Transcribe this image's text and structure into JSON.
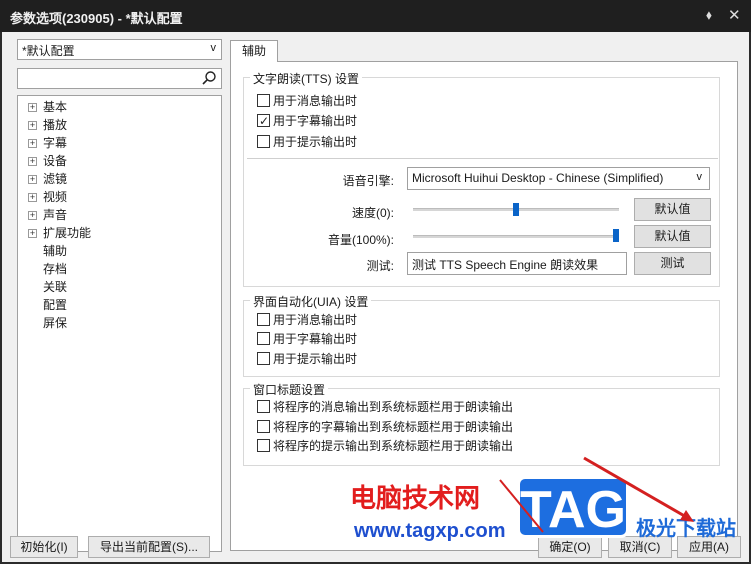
{
  "window": {
    "title": "参数选项(230905) - *默认配置",
    "pin_icon": "pin-icon",
    "close_icon": "close-icon"
  },
  "left": {
    "profile_select": "*默认配置",
    "search_placeholder": "",
    "tree": [
      {
        "label": "基本",
        "expandable": true
      },
      {
        "label": "播放",
        "expandable": true
      },
      {
        "label": "字幕",
        "expandable": true
      },
      {
        "label": "设备",
        "expandable": true
      },
      {
        "label": "滤镜",
        "expandable": true
      },
      {
        "label": "视频",
        "expandable": true
      },
      {
        "label": "声音",
        "expandable": true
      },
      {
        "label": "扩展功能",
        "expandable": true
      },
      {
        "label": "辅助",
        "expandable": false
      },
      {
        "label": "存档",
        "expandable": false
      },
      {
        "label": "关联",
        "expandable": false
      },
      {
        "label": "配置",
        "expandable": false
      },
      {
        "label": "屏保",
        "expandable": false
      }
    ]
  },
  "tab": {
    "label": "辅助"
  },
  "tts": {
    "title": "文字朗读(TTS) 设置",
    "checks": [
      {
        "label": "用于消息输出时",
        "checked": false
      },
      {
        "label": "用于字幕输出时",
        "checked": true
      },
      {
        "label": "用于提示输出时",
        "checked": false
      }
    ],
    "engine_label": "语音引擎:",
    "engine_value": "Microsoft Huihui Desktop - Chinese (Simplified)",
    "speed_label": "速度(0):",
    "speed_value": 0.5,
    "volume_label": "音量(100%):",
    "volume_value": 1.0,
    "default_button": "默认值",
    "test_label": "测试:",
    "test_text": "测试 TTS Speech Engine 朗读效果",
    "test_button": "测试"
  },
  "uia": {
    "title": "界面自动化(UIA) 设置",
    "checks": [
      {
        "label": "用于消息输出时",
        "checked": false
      },
      {
        "label": "用于字幕输出时",
        "checked": false
      },
      {
        "label": "用于提示输出时",
        "checked": false
      }
    ]
  },
  "caption": {
    "title": "窗口标题设置",
    "checks": [
      {
        "label": "将程序的消息输出到系统标题栏用于朗读输出",
        "checked": false
      },
      {
        "label": "将程序的字幕输出到系统标题栏用于朗读输出",
        "checked": false
      },
      {
        "label": "将程序的提示输出到系统标题栏用于朗读输出",
        "checked": false
      }
    ]
  },
  "bottom": {
    "init": "初始化(I)",
    "export": "导出当前配置(S)...",
    "ok": "确定(O)",
    "cancel": "取消(C)",
    "apply": "应用(A)"
  },
  "watermark": {
    "line1": "电脑技术网",
    "line2": "www.tagxp.com",
    "badge": "TAG",
    "line3": "极光下载站"
  },
  "colors": {
    "accent": "#0a64c8",
    "titlebar": "#1f1f1f",
    "watermark_red": "#e21d1d",
    "watermark_blue": "#1d6ee0"
  }
}
